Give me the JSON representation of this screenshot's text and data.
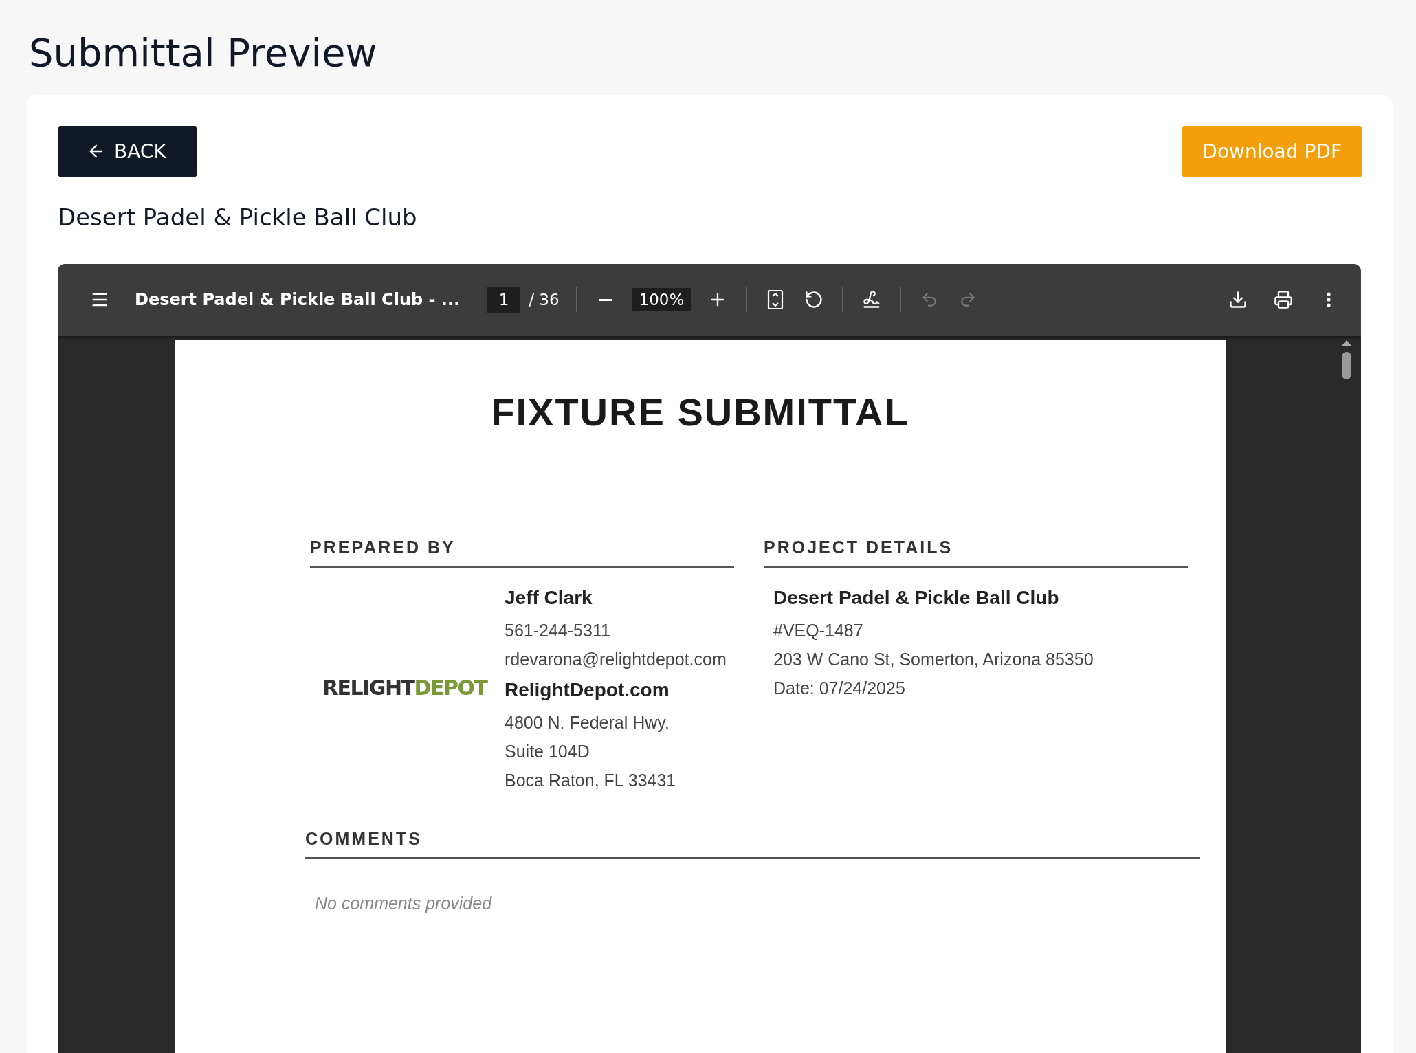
{
  "page_title": "Submittal Preview",
  "back_button": {
    "label": "BACK"
  },
  "download_button": {
    "label": "Download PDF"
  },
  "project_name": "Desert Padel & Pickle Ball Club",
  "viewer": {
    "doc_title": "Desert Padel & Pickle Ball Club - ...",
    "page_number": "1",
    "page_count": "/ 36",
    "zoom": "100%",
    "history": [
      {
        "kind": "undo",
        "disabled": true
      },
      {
        "kind": "redo",
        "disabled": true
      }
    ]
  },
  "document": {
    "title": "FIXTURE SUBMITTAL",
    "prepared_by": {
      "heading": "PREPARED BY",
      "logo": [
        "RELIGHT",
        "DEPOT"
      ],
      "name": "Jeff Clark",
      "phone": "561-244-5311",
      "email": "rdevarona@relightdepot.com",
      "website": "RelightDepot.com",
      "address": [
        "4800 N. Federal Hwy.",
        "Suite 104D",
        "Boca Raton, FL 33431"
      ]
    },
    "project_details": {
      "heading": "PROJECT DETAILS",
      "name": "Desert Padel & Pickle Ball Club",
      "number": "#VEQ-1487",
      "address": "203 W Cano St, Somerton, Arizona 85350",
      "date": "Date: 07/24/2025"
    },
    "comments": {
      "heading": "COMMENTS",
      "text": "No comments provided"
    }
  }
}
